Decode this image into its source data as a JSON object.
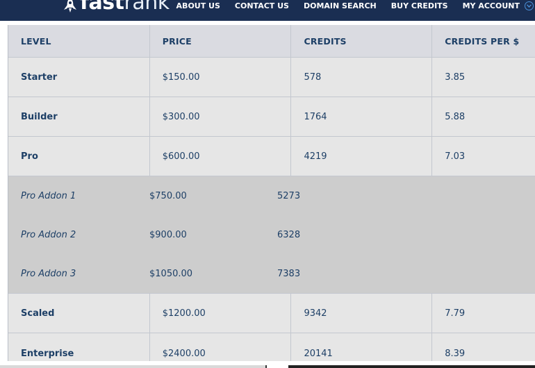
{
  "header": {
    "logo": {
      "bold_text": "fast",
      "light_text": "rank",
      "icon": "rocket-icon"
    },
    "nav": [
      {
        "label": "ABOUT US"
      },
      {
        "label": "CONTACT US"
      },
      {
        "label": "DOMAIN SEARCH"
      },
      {
        "label": "BUY CREDITS"
      },
      {
        "label": "MY ACCOUNT"
      }
    ],
    "account_icon": "chevron-down-circle-icon"
  },
  "pricing_table": {
    "columns": [
      "LEVEL",
      "PRICE",
      "CREDITS",
      "CREDITS PER $"
    ],
    "rows": [
      {
        "level": "Starter",
        "price": "$150.00",
        "credits": "578",
        "per_dollar": "3.85"
      },
      {
        "level": "Builder",
        "price": "$300.00",
        "credits": "1764",
        "per_dollar": "5.88"
      },
      {
        "level": "Pro",
        "price": "$600.00",
        "credits": "4219",
        "per_dollar": "7.03"
      }
    ],
    "addons": [
      {
        "level": "Pro Addon 1",
        "price": "$750.00",
        "credits": "5273"
      },
      {
        "level": "Pro Addon 2",
        "price": "$900.00",
        "credits": "6328"
      },
      {
        "level": "Pro Addon 3",
        "price": "$1050.00",
        "credits": "7383"
      }
    ],
    "rows_after": [
      {
        "level": "Scaled",
        "price": "$1200.00",
        "credits": "9342",
        "per_dollar": "7.79"
      },
      {
        "level": "Enterprise",
        "price": "$2400.00",
        "credits": "20141",
        "per_dollar": "8.39"
      }
    ]
  },
  "colors": {
    "nav_bg": "#1a2e52",
    "header_row_bg": "#dadbe1",
    "row_bg": "#e6e6e6",
    "addon_bg": "#cdcdcd",
    "text": "#1d3f66",
    "accent": "#4a90d9"
  }
}
